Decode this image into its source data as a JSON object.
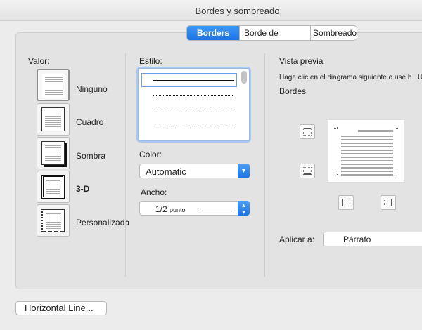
{
  "window": {
    "title": "Bordes y sombreado"
  },
  "tabs": [
    {
      "label": "Borders",
      "active": true
    },
    {
      "label": "Borde de página",
      "active": false
    },
    {
      "label": "Sombreado",
      "active": false
    }
  ],
  "setting": {
    "heading": "Valor:",
    "items": [
      {
        "label": "Ninguno",
        "selected": true
      },
      {
        "label": "Cuadro",
        "selected": false
      },
      {
        "label": "Sombra",
        "selected": false
      },
      {
        "label": "3-D",
        "selected": false
      },
      {
        "label": "Personalizada",
        "selected": false
      }
    ]
  },
  "style": {
    "heading": "Estilo:",
    "options": [
      "solid",
      "dotted",
      "dashed",
      "long-dashed"
    ],
    "selected_index": 0
  },
  "color": {
    "heading": "Color:",
    "value": "Automatic"
  },
  "width": {
    "heading": "Ancho:",
    "value": "1/2",
    "unit": "punto"
  },
  "preview": {
    "heading": "Vista previa",
    "hint": "Haga clic en el diagrama siguiente o use b",
    "hint_cut": "U",
    "sub_heading": "Bordes"
  },
  "apply_to": {
    "label": "Aplicar a:",
    "value": "Párrafo"
  },
  "footer": {
    "horizontal_line_button": "Horizontal Line..."
  },
  "colors": {
    "accent": "#1b74e4",
    "panel": "#e3e3e3",
    "window": "#ececec"
  }
}
